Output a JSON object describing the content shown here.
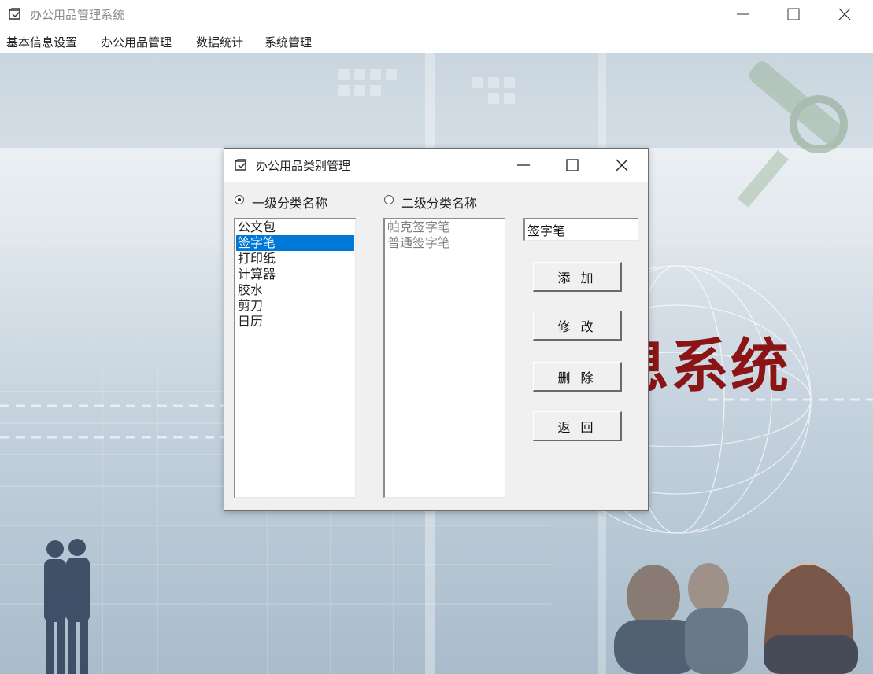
{
  "window": {
    "title": "办公用品管理系统",
    "icon": "app-window-icon"
  },
  "menu": {
    "items": [
      "基本信息设置",
      "办公用品管理",
      "数据统计",
      "系统管理"
    ]
  },
  "background": {
    "banner_text": "信息系统",
    "banner_color": "#8b1414"
  },
  "dialog": {
    "title": "办公用品类别管理",
    "radio_level1": {
      "label": "一级分类名称",
      "checked": true
    },
    "radio_level2": {
      "label": "二级分类名称",
      "checked": false
    },
    "level1_items": [
      "公文包",
      "签字笔",
      "打印纸",
      "计算器",
      "胶水",
      "剪刀",
      "日历"
    ],
    "level1_selected": "签字笔",
    "level2_items": [
      "帕克签字笔",
      "普通签字笔"
    ],
    "name_input_value": "签字笔",
    "buttons": {
      "add": "添 加",
      "edit": "修 改",
      "delete": "删 除",
      "return": "返 回"
    },
    "selection_color": "#0078d7"
  }
}
